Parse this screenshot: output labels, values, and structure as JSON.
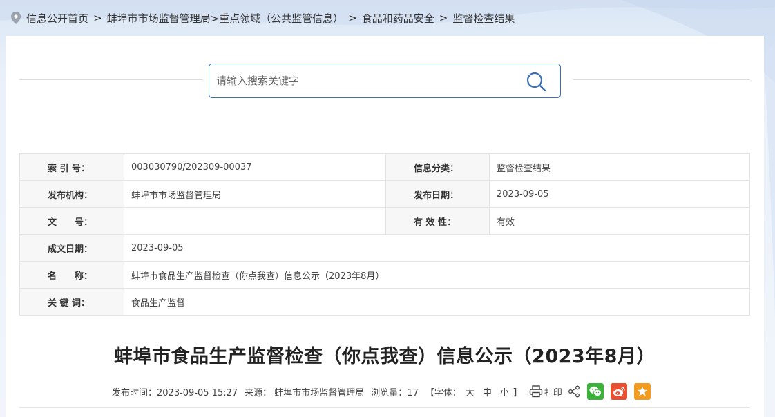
{
  "breadcrumb": {
    "items": [
      {
        "label": "信息公开首页"
      },
      {
        "label": "蚌埠市市场监督管理局>重点领域（公共监管信息）"
      },
      {
        "label": "食品和药品安全"
      },
      {
        "label": "监督检查结果"
      }
    ],
    "separator": ">"
  },
  "search": {
    "placeholder": "请输入搜索关键字",
    "value": ""
  },
  "meta": {
    "index_no_label": "索 引 号：",
    "index_no": "003030790/202309-00037",
    "category_label": "信息分类：",
    "category": "监督检查结果",
    "publisher_label": "发布机构：",
    "publisher": "蚌埠市市场监督管理局",
    "publish_date_label": "发布日期：",
    "publish_date": "2023-09-05",
    "doc_no_label": "文　　号：",
    "doc_no": "",
    "validity_label": "有 效 性：",
    "validity": "有效",
    "created_date_label": "成文日期：",
    "created_date": "2023-09-05",
    "name_label": "名　　称：",
    "name": "蚌埠市食品生产监督检查（你点我查）信息公示（2023年8月）",
    "keywords_label": "关 键 词：",
    "keywords": "食品生产监督"
  },
  "article": {
    "title": "蚌埠市食品生产监督检查（你点我查）信息公示（2023年8月）",
    "publish_time": "发布时间：2023-09-05 15:27",
    "source": "来源： 蚌埠市市场监督管理局",
    "views": "浏览量：17",
    "font_prefix": "【字体：",
    "font_large": "大",
    "font_medium": "中",
    "font_small": "小",
    "font_suffix": "】",
    "print_label": "打印"
  },
  "colors": {
    "accent": "#3d6fb6",
    "wechat": "#3bb33a",
    "weibo": "#e8502f",
    "favorite": "#f29c1f"
  },
  "icons": {
    "location": "location-pin-icon",
    "search": "search-icon",
    "print": "print-icon",
    "share": "share-icon",
    "wechat": "wechat-icon",
    "weibo": "weibo-icon",
    "favorite": "star-icon"
  }
}
